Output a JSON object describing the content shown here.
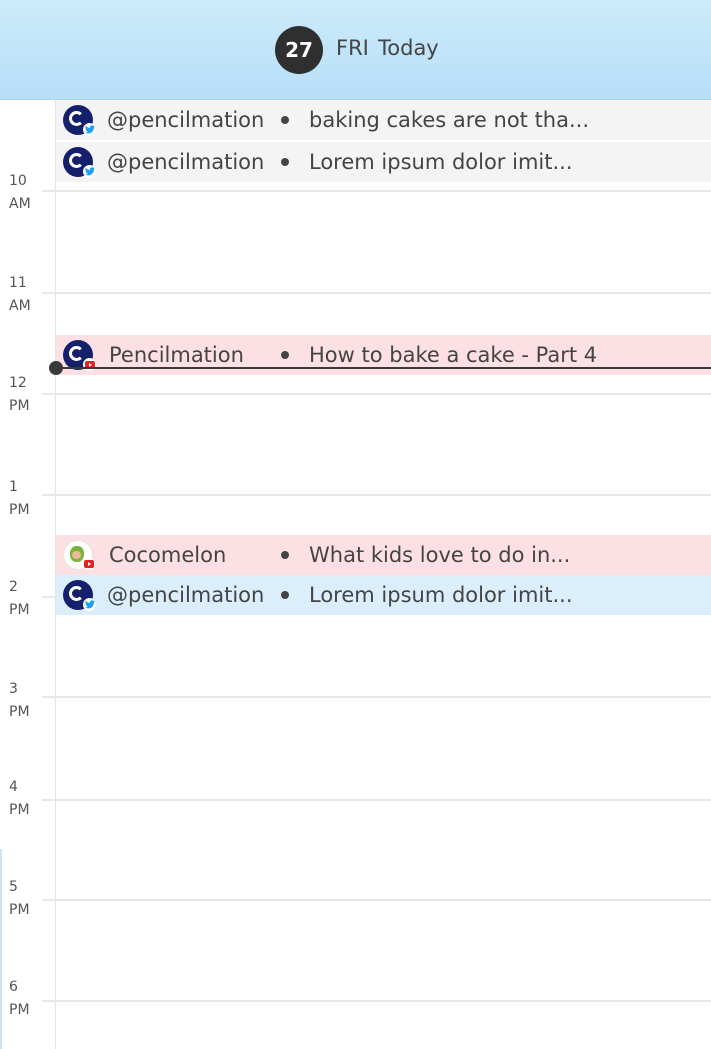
{
  "header": {
    "date_number": "27",
    "day": "FRI",
    "today": "Today"
  },
  "hours": [
    {
      "h": "10",
      "ap": "AM"
    },
    {
      "h": "11",
      "ap": "AM"
    },
    {
      "h": "12",
      "ap": "PM"
    },
    {
      "h": "1",
      "ap": "PM"
    },
    {
      "h": "2",
      "ap": "PM"
    },
    {
      "h": "3",
      "ap": "PM"
    },
    {
      "h": "4",
      "ap": "PM"
    },
    {
      "h": "5",
      "ap": "PM"
    },
    {
      "h": "6",
      "ap": "PM"
    }
  ],
  "events": [
    {
      "account": "@pencilmation",
      "title": "baking cakes are not tha...",
      "platform": "twitter"
    },
    {
      "account": "@pencilmation",
      "title": "Lorem ipsum dolor imit...",
      "platform": "twitter"
    },
    {
      "account": "Pencilmation",
      "title": "How to bake a cake - Part 4",
      "platform": "youtube"
    },
    {
      "account": "Cocomelon",
      "title": "What kids love to do in...",
      "platform": "youtube"
    },
    {
      "account": "@pencilmation",
      "title": "Lorem ipsum dolor imit...",
      "platform": "twitter"
    }
  ],
  "colors": {
    "header_bg": "#c4e6fa",
    "twitter_event_bg": "#daeefc",
    "youtube_event_bg": "#fde0e3",
    "past_event_bg": "#f4f4f4",
    "twitter_blue": "#1da1f2",
    "youtube_red": "#e52222"
  }
}
